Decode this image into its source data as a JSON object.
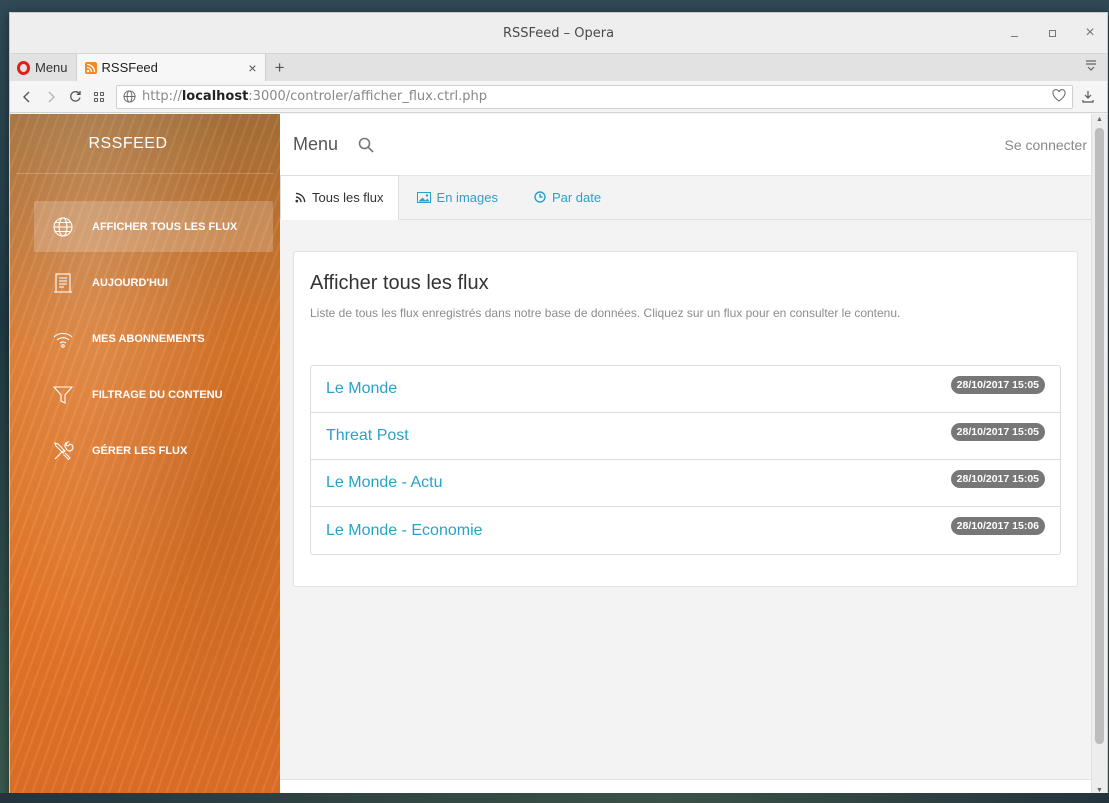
{
  "window": {
    "title": "RSSFeed – Opera",
    "controls": {
      "minimize": "–",
      "maximize": "□",
      "close": "×"
    }
  },
  "browser": {
    "menu_label": "Menu",
    "tab": {
      "title": "RSSFeed",
      "close": "×"
    },
    "new_tab": "+",
    "url": {
      "scheme": "http://",
      "host": "localhost",
      "rest": ":3000/controler/afficher_flux.ctrl.php"
    }
  },
  "sidebar": {
    "brand": "RSSFEED",
    "items": [
      {
        "label": "AFFICHER TOUS LES FLUX",
        "icon": "globe-icon",
        "active": true
      },
      {
        "label": "AUJOURD'HUI",
        "icon": "document-icon",
        "active": false
      },
      {
        "label": "MES ABONNEMENTS",
        "icon": "wifi-icon",
        "active": false
      },
      {
        "label": "FILTRAGE DU CONTENU",
        "icon": "filter-icon",
        "active": false
      },
      {
        "label": "GÉRER LES FLUX",
        "icon": "tools-icon",
        "active": false
      }
    ]
  },
  "navbar": {
    "menu_title": "Menu",
    "login": "Se connecter"
  },
  "tabs": [
    {
      "label": "Tous les flux",
      "icon": "rss-icon",
      "active": true
    },
    {
      "label": "En images",
      "icon": "image-icon",
      "active": false
    },
    {
      "label": "Par date",
      "icon": "clock-icon",
      "active": false
    }
  ],
  "main": {
    "title": "Afficher tous les flux",
    "description": "Liste de tous les flux enregistrés dans notre base de données. Cliquez sur un flux pour en consulter le contenu.",
    "feeds": [
      {
        "name": "Le Monde",
        "date": "28/10/2017 15:05"
      },
      {
        "name": "Threat Post",
        "date": "28/10/2017 15:05"
      },
      {
        "name": "Le Monde - Actu",
        "date": "28/10/2017 15:05"
      },
      {
        "name": "Le Monde - Economie",
        "date": "28/10/2017 15:06"
      }
    ]
  },
  "colors": {
    "accent": "#28a2c9",
    "sidebar": "#e07a30",
    "badge": "#777777",
    "opera_red": "#e01e1e"
  }
}
